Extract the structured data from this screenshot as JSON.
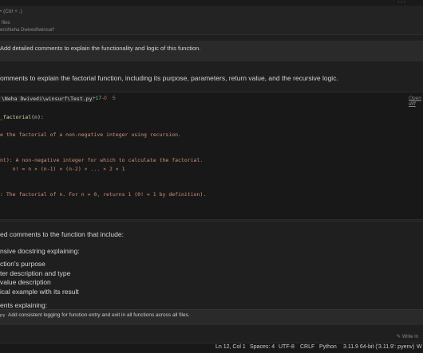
{
  "header": {
    "shortcut_hint": "• (Ctrl + .)",
    "context_files": "files",
    "context_path": "ers\\Neha Dwivedi\\winsurf"
  },
  "user_message": "Add detailed comments to explain the functionality and logic of this function.",
  "assistant_intro": "omments to explain the factorial function, including its purpose, parameters, return value, and the recursive logic.",
  "code_block": {
    "file_path": "\\Neha Dwivedi\\winsurf\\Test.py",
    "additions": "+17",
    "deletions": "-0",
    "modifications": "5",
    "open_diff_label": "Open diff",
    "lines": {
      "def_name": "_factorial",
      "def_rest": "(n):",
      "doc1": "e the factorial of a non-negative integer using recursion.",
      "arg": "nt): A non-negative integer for which to calculate the factorial.",
      "formula": "    n! = n × (n-1) × (n-2) × ... × 2 × 1",
      "ret": ": The factorial of n. For n = 0, returns 1 (0! = 1 by definition)."
    }
  },
  "assistant_summary": "ed comments to the function that include:",
  "bullets": {
    "docstring": "nsive docstring explaining:",
    "purpose": "ction's purpose",
    "param": "ter description and type",
    "return": "value description",
    "example": "ical example with its result",
    "comments": "ents explaining:"
  },
  "suggestion": {
    "tag": "py",
    "text": "Add consistent logging for function entry and exit in all functions across all files."
  },
  "input": {
    "write_label": "✎ Write m"
  },
  "status_bar": {
    "position": "Ln 12, Col 1",
    "spaces": "Spaces: 4",
    "encoding": "UTF-8",
    "eol": "CRLF",
    "language": "Python",
    "interpreter": "3.11.9 64-bit ('3.11.9': pyenv)",
    "bell_icon": "W"
  },
  "colors": {
    "background": "#1f1f1f",
    "code_background": "#181818",
    "docstring": "#ce9178",
    "function": "#dcdcaa",
    "diff_add": "#73c991",
    "diff_del": "#e06c6c"
  }
}
